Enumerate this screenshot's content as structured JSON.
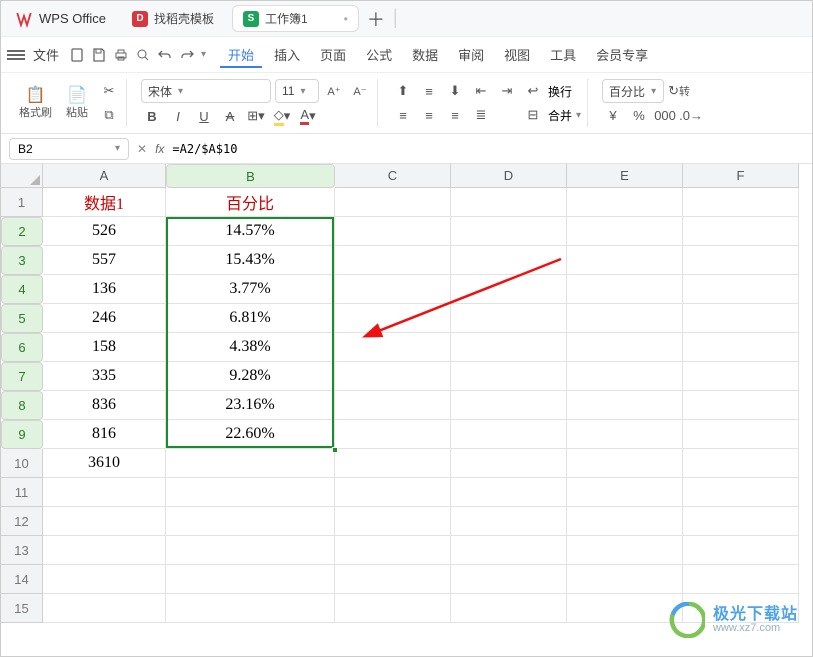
{
  "title": {
    "brand": "WPS Office"
  },
  "tabs": [
    {
      "icon_bg": "#d9363e",
      "icon_txt": "D",
      "label": "找稻壳模板"
    },
    {
      "icon_bg": "#1fa35a",
      "icon_txt": "S",
      "label": "工作簿1"
    }
  ],
  "menubar": {
    "file": "文件",
    "items": [
      "开始",
      "插入",
      "页面",
      "公式",
      "数据",
      "审阅",
      "视图",
      "工具",
      "会员专享"
    ],
    "active": 0
  },
  "ribbon": {
    "format_painter": "格式刷",
    "paste": "粘贴",
    "font_name": "宋体",
    "font_size": "11",
    "wrap": "换行",
    "merge": "合并",
    "numfmt": "百分比",
    "currency": "¥",
    "percent": "%",
    "comma": "000",
    "trans": "转"
  },
  "formulabar": {
    "cell": "B2",
    "formula": "=A2/$A$10"
  },
  "cols": [
    "A",
    "B",
    "C",
    "D",
    "E",
    "F"
  ],
  "rows": [
    "1",
    "2",
    "3",
    "4",
    "5",
    "6",
    "7",
    "8",
    "9",
    "10",
    "11",
    "12",
    "13",
    "14",
    "15"
  ],
  "headers": {
    "A": "数据1",
    "B": "百分比"
  },
  "dataA": [
    "526",
    "557",
    "136",
    "246",
    "158",
    "335",
    "836",
    "816",
    "3610"
  ],
  "dataB": [
    "14.57%",
    "15.43%",
    "3.77%",
    "6.81%",
    "4.38%",
    "9.28%",
    "23.16%",
    "22.60%"
  ],
  "watermark": {
    "line1": "极光下载站",
    "line2": "www.xz7.com"
  }
}
